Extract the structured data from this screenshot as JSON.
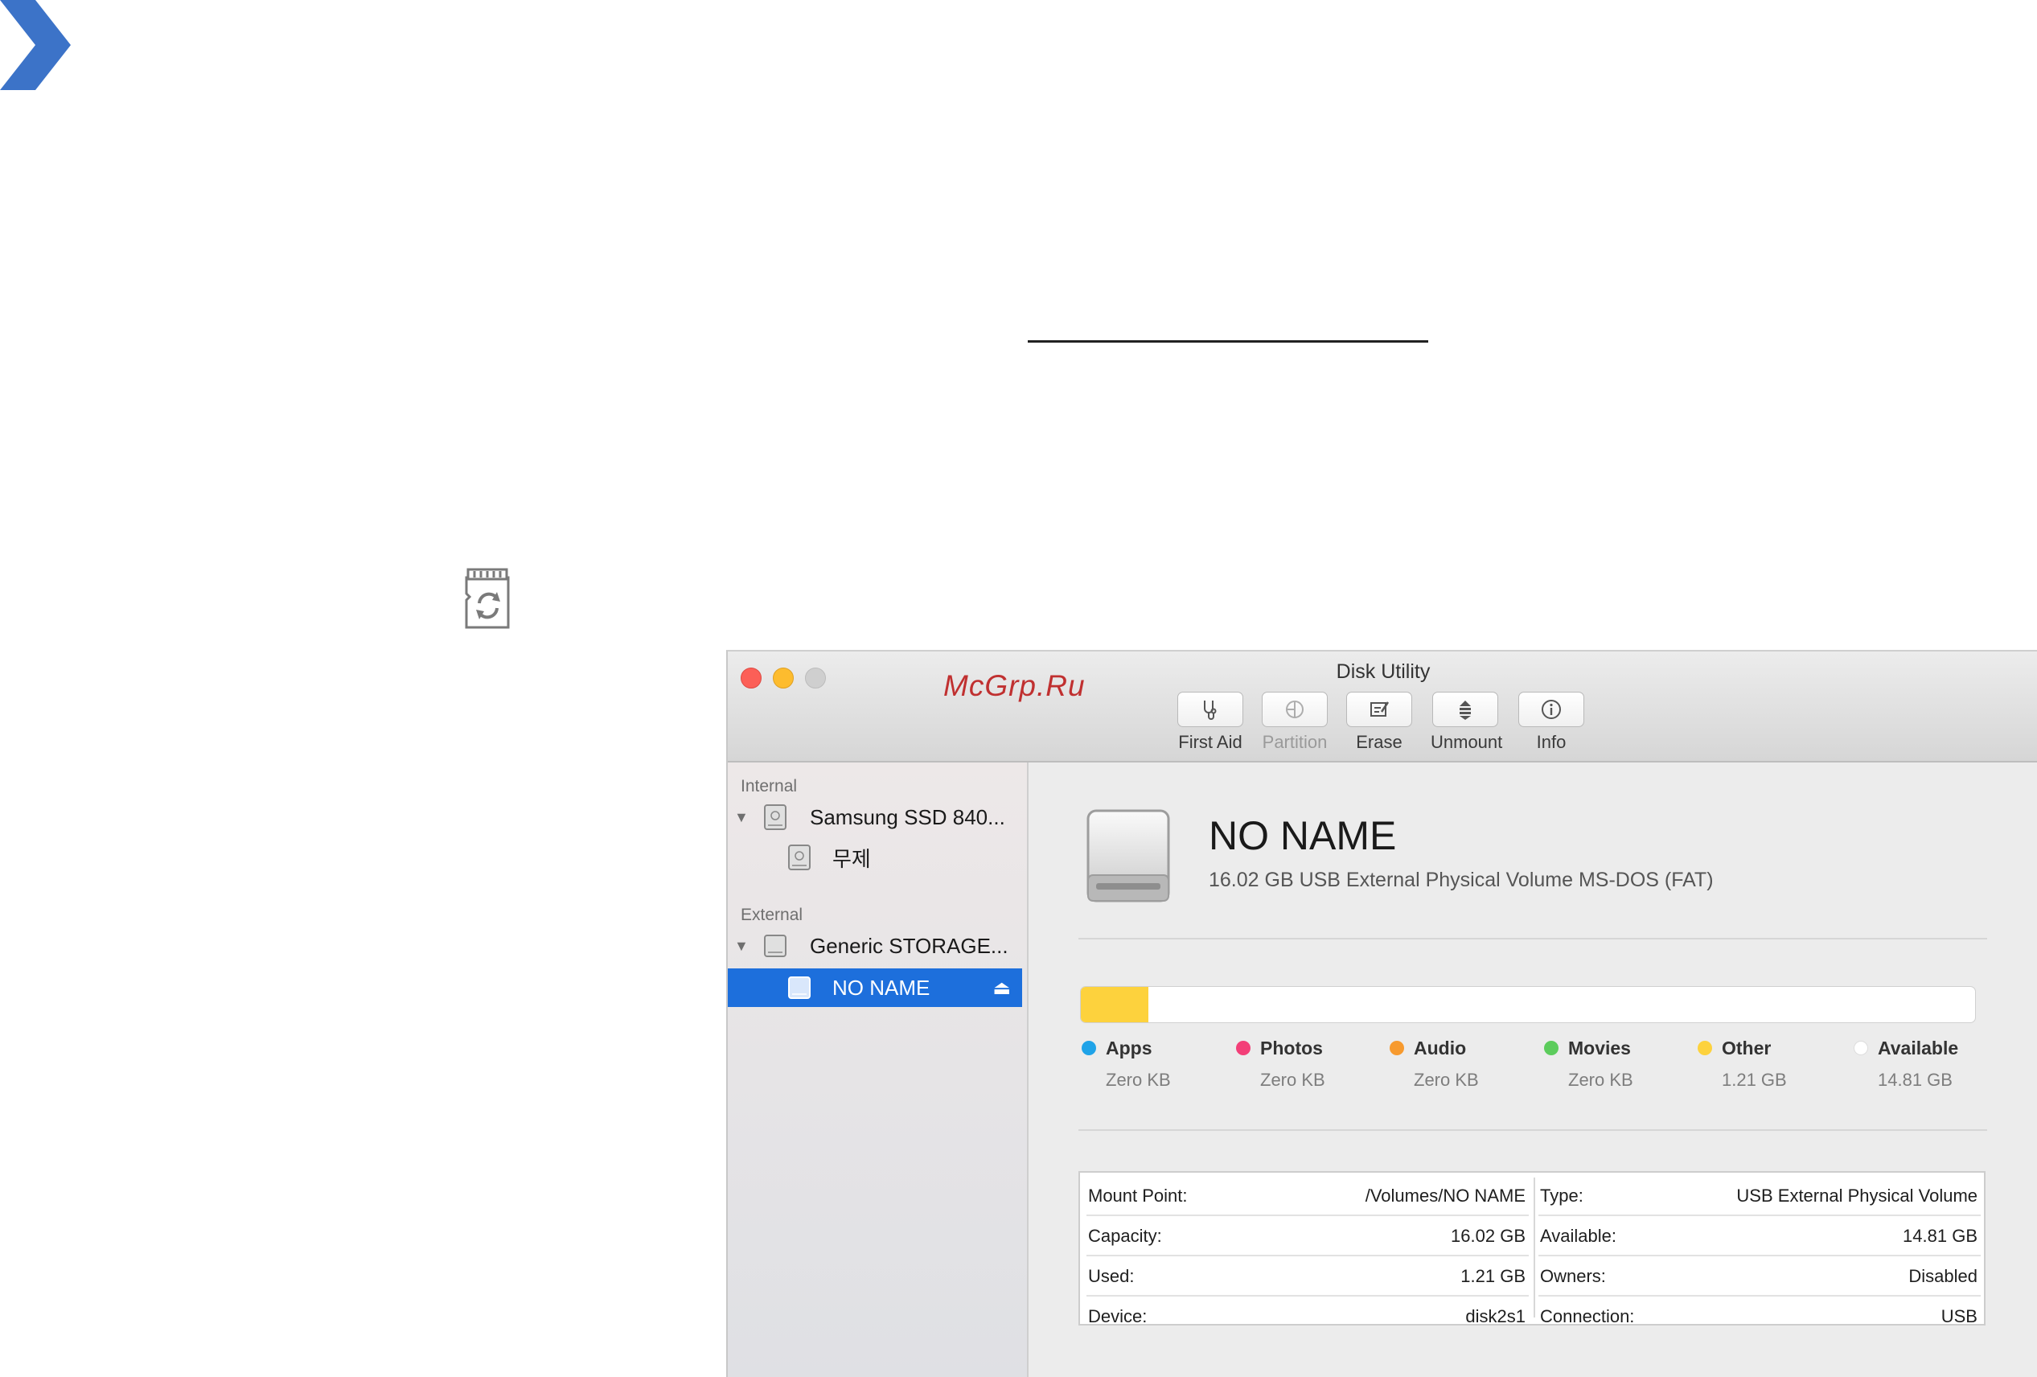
{
  "watermark": "McGrp.Ru",
  "window": {
    "title": "Disk Utility",
    "toolbar": [
      {
        "label": "First Aid",
        "icon": "stethoscope-icon",
        "enabled": true
      },
      {
        "label": "Partition",
        "icon": "partition-icon",
        "enabled": false
      },
      {
        "label": "Erase",
        "icon": "erase-icon",
        "enabled": true
      },
      {
        "label": "Unmount",
        "icon": "unmount-icon",
        "enabled": true
      },
      {
        "label": "Info",
        "icon": "info-icon",
        "enabled": true
      }
    ]
  },
  "sidebar": {
    "internal_label": "Internal",
    "external_label": "External",
    "items": [
      {
        "label": "Samsung SSD 840...",
        "kind": "disk",
        "expanded": true
      },
      {
        "label": "무제",
        "kind": "volume"
      },
      {
        "label": "Generic STORAGE...",
        "kind": "disk",
        "expanded": true
      },
      {
        "label": "NO NAME",
        "kind": "volume",
        "selected": true
      }
    ]
  },
  "volume": {
    "name": "NO NAME",
    "description": "16.02 GB USB External Physical Volume MS-DOS (FAT)",
    "used_fraction": 0.0755
  },
  "legend": [
    {
      "name": "Apps",
      "value": "Zero KB",
      "color": "#1fa3e8"
    },
    {
      "name": "Photos",
      "value": "Zero KB",
      "color": "#f33f78"
    },
    {
      "name": "Audio",
      "value": "Zero KB",
      "color": "#f79a2e"
    },
    {
      "name": "Movies",
      "value": "Zero KB",
      "color": "#5ccc5c"
    },
    {
      "name": "Other",
      "value": "1.21 GB",
      "color": "#fdd23d"
    },
    {
      "name": "Available",
      "value": "14.81 GB",
      "color": "#ffffff"
    }
  ],
  "info": {
    "left": [
      {
        "key": "Mount Point:",
        "value": "/Volumes/NO NAME"
      },
      {
        "key": "Capacity:",
        "value": "16.02 GB"
      },
      {
        "key": "Used:",
        "value": "1.21 GB"
      },
      {
        "key": "Device:",
        "value": "disk2s1"
      }
    ],
    "right": [
      {
        "key": "Type:",
        "value": "USB External Physical Volume"
      },
      {
        "key": "Available:",
        "value": "14.81 GB"
      },
      {
        "key": "Owners:",
        "value": "Disabled"
      },
      {
        "key": "Connection:",
        "value": "USB"
      }
    ]
  }
}
